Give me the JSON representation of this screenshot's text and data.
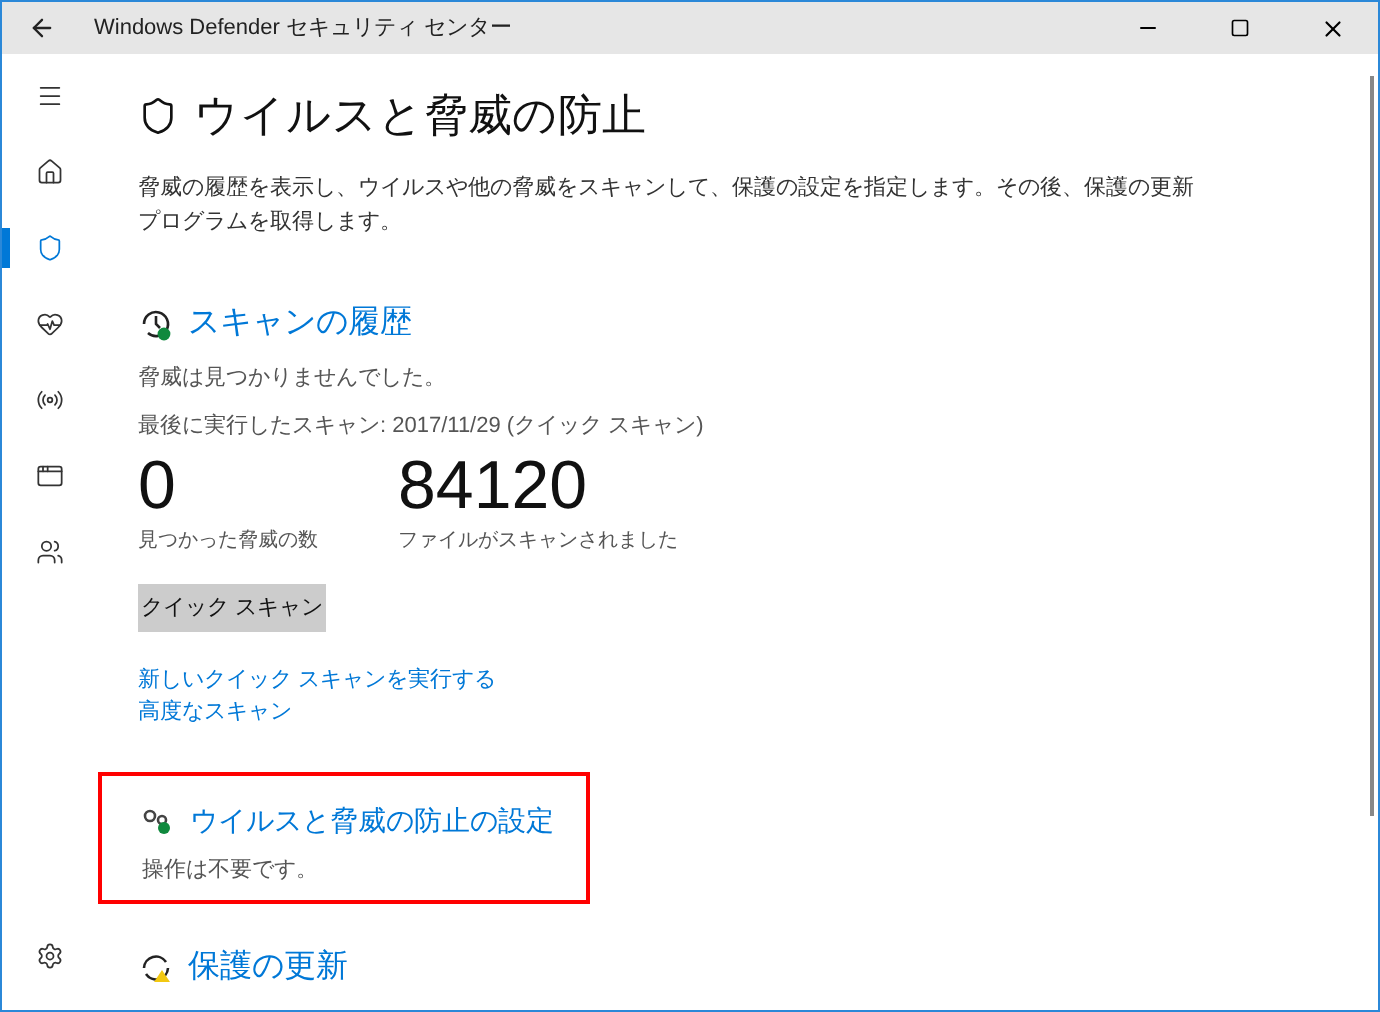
{
  "window": {
    "title": "Windows Defender セキュリティ センター"
  },
  "sidebar": {
    "items": [
      {
        "kind": "menu",
        "selected": false
      },
      {
        "kind": "home",
        "selected": false
      },
      {
        "kind": "shield",
        "selected": true
      },
      {
        "kind": "health",
        "selected": false
      },
      {
        "kind": "network",
        "selected": false
      },
      {
        "kind": "app",
        "selected": false
      },
      {
        "kind": "family",
        "selected": false
      }
    ],
    "settings": {
      "kind": "settings"
    }
  },
  "page": {
    "title": "ウイルスと脅威の防止",
    "description": "脅威の履歴を表示し、ウイルスや他の脅威をスキャンして、保護の設定を指定します。その後、保護の更新プログラムを取得します。"
  },
  "scan_history": {
    "title": "スキャンの履歴",
    "status": "脅威は見つかりませんでした。",
    "last_scan": "最後に実行したスキャン: 2017/11/29 (クイック スキャン)",
    "stats": [
      {
        "value": "0",
        "label": "見つかった脅威の数"
      },
      {
        "value": "84120",
        "label": "ファイルがスキャンされました"
      }
    ],
    "button": "クイック スキャン",
    "links": [
      "新しいクイック スキャンを実行する",
      "高度なスキャン"
    ]
  },
  "settings_section": {
    "title": "ウイルスと脅威の防止の設定",
    "status": "操作は不要です。",
    "highlighted": true
  },
  "updates_section": {
    "title": "保護の更新"
  }
}
